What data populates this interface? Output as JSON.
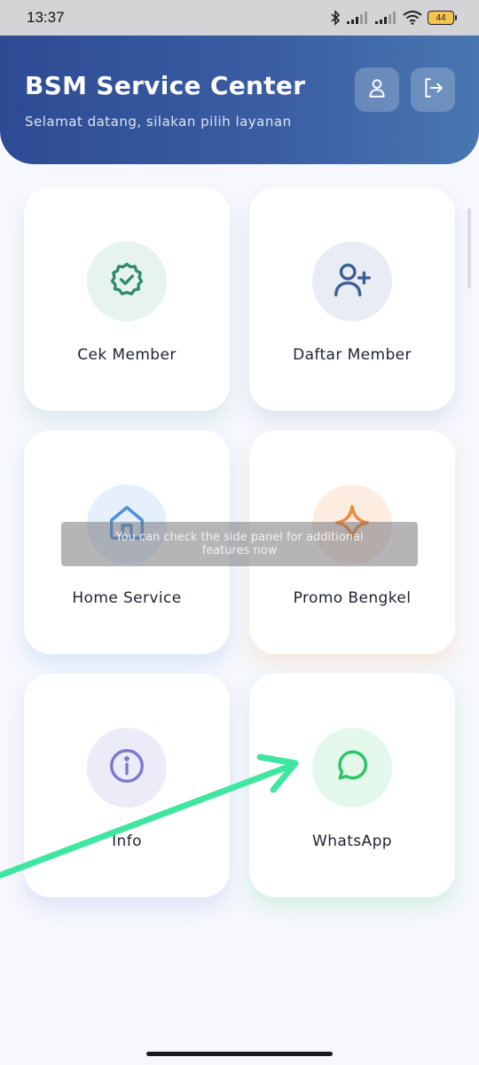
{
  "status_bar": {
    "time": "13:37",
    "battery": "44",
    "icons": [
      "bluetooth-icon",
      "signal-icon",
      "signal-icon",
      "wifi-icon",
      "battery-icon"
    ]
  },
  "header": {
    "title": "BSM Service Center",
    "subtitle": "Selamat datang, silakan pilih layanan",
    "buttons": [
      "profile-icon",
      "logout-icon"
    ]
  },
  "menu": {
    "cards": [
      {
        "label": "Cek Member",
        "icon": "badge-check-icon",
        "color": "#2f8a6e"
      },
      {
        "label": "Daftar Member",
        "icon": "user-plus-icon",
        "color": "#3d5f96"
      },
      {
        "label": "Home Service",
        "icon": "home-icon",
        "color": "#4a8fe0"
      },
      {
        "label": "Promo Bengkel",
        "icon": "sparkle-icon",
        "color": "#ee8a36"
      },
      {
        "label": "Info",
        "icon": "info-icon",
        "color": "#7c78d3"
      },
      {
        "label": "WhatsApp",
        "icon": "chat-icon",
        "color": "#2ec46a"
      }
    ]
  },
  "toast": {
    "text": "You can check the side panel for additional features now"
  },
  "annotation": {
    "arrow_color": "#3ee6a0"
  }
}
